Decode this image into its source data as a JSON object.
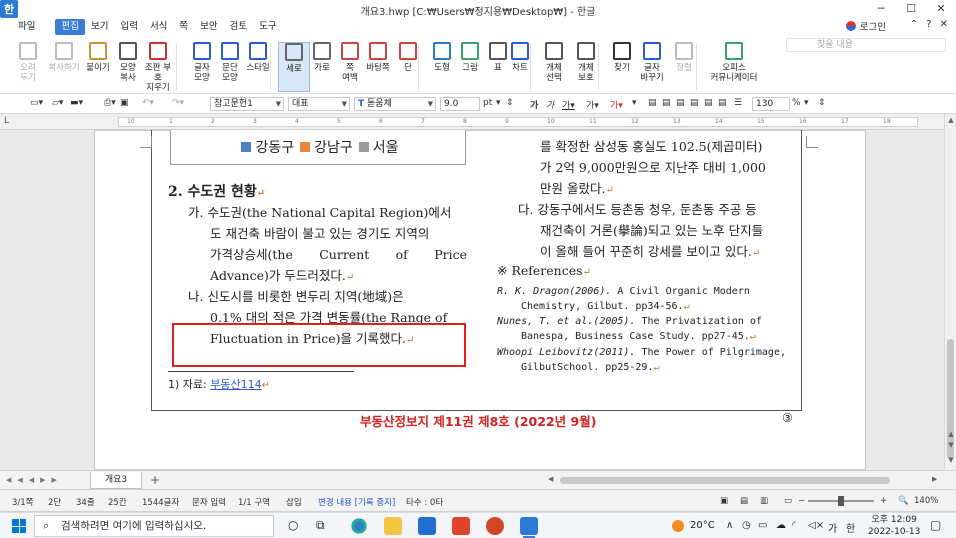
{
  "window": {
    "title": "개요3.hwp [C:₩Users₩정지용₩Desktop₩] - 한글",
    "app_logo": "한",
    "controls": [
      "─",
      "☐",
      "✕"
    ]
  },
  "menubar": {
    "items": [
      "파일",
      "편집",
      "보기",
      "입력",
      "서식",
      "쪽",
      "보안",
      "검토",
      "도구"
    ],
    "active": "편집",
    "login": "로그인",
    "right": [
      "⌃",
      "?",
      "✕"
    ]
  },
  "ribbon": {
    "search_placeholder": "찾을 내용",
    "buttons": [
      {
        "label1": "오려",
        "label2": "두기",
        "icon": "scissors-icon",
        "disabled": true
      },
      {
        "label1": "복사하기",
        "label2": "",
        "icon": "copy-icon",
        "disabled": true
      },
      {
        "label1": "붙이기",
        "label2": "",
        "icon": "paste-icon",
        "disabled": false
      },
      {
        "label1": "모양",
        "label2": "복사",
        "icon": "format-painter-icon",
        "disabled": false
      },
      {
        "label1": "조판 부호",
        "label2": "지우기",
        "icon": "clear-codes-icon",
        "disabled": false
      },
      {
        "label1": "글자",
        "label2": "모양",
        "icon": "char-shape-icon",
        "disabled": false
      },
      {
        "label1": "문단",
        "label2": "모양",
        "icon": "para-shape-icon",
        "disabled": false
      },
      {
        "label1": "스타일",
        "label2": "",
        "icon": "style-icon",
        "disabled": false
      },
      {
        "label1": "세로",
        "label2": "",
        "icon": "portrait-icon",
        "disabled": false,
        "selected": true
      },
      {
        "label1": "가로",
        "label2": "",
        "icon": "landscape-icon",
        "disabled": false
      },
      {
        "label1": "쪽",
        "label2": "여백",
        "icon": "margin-icon",
        "disabled": false
      },
      {
        "label1": "바탕쪽",
        "label2": "",
        "icon": "master-page-icon",
        "disabled": false
      },
      {
        "label1": "단",
        "label2": "",
        "icon": "columns-icon",
        "disabled": false
      },
      {
        "label1": "도형",
        "label2": "",
        "icon": "shapes-icon",
        "disabled": false
      },
      {
        "label1": "그림",
        "label2": "",
        "icon": "picture-icon",
        "disabled": false
      },
      {
        "label1": "표",
        "label2": "",
        "icon": "table-icon",
        "disabled": false
      },
      {
        "label1": "차트",
        "label2": "",
        "icon": "chart-icon",
        "disabled": false
      },
      {
        "label1": "개체",
        "label2": "선택",
        "icon": "object-select-icon",
        "disabled": false
      },
      {
        "label1": "개체",
        "label2": "보호",
        "icon": "object-protect-icon",
        "disabled": false
      },
      {
        "label1": "찾기",
        "label2": "",
        "icon": "find-icon",
        "disabled": false
      },
      {
        "label1": "글자",
        "label2": "바꾸기",
        "icon": "replace-icon",
        "disabled": false
      },
      {
        "label1": "정렬",
        "label2": "",
        "icon": "sort-icon",
        "disabled": true
      },
      {
        "label1": "오피스",
        "label2": "커뮤니케이터",
        "icon": "communicator-icon",
        "disabled": false
      }
    ]
  },
  "format": {
    "style": "참고문헌1",
    "lang": "대표",
    "font": "돋움체",
    "size": "9.0",
    "unit": "pt",
    "zoom": "130",
    "zoom_unit": "%",
    "font_icon": "T"
  },
  "ruler": {
    "ticks": [
      "10",
      "1",
      "2",
      "3",
      "4",
      "5",
      "6",
      "7",
      "8",
      "9",
      "10",
      "11",
      "12",
      "13",
      "14",
      "15",
      "16",
      "17",
      "18"
    ]
  },
  "document": {
    "legend": [
      {
        "label": "강동구",
        "color": "#4f7ec9"
      },
      {
        "label": "강남구",
        "color": "#e8883a"
      },
      {
        "label": "서울",
        "color": "#9a9a9a"
      }
    ],
    "section_title": "2. 수도권 현황",
    "left_col": [
      [
        "가. 수도권(the National Capital Region)에서"
      ],
      [
        "도 재건축 바람이 불고 있는 경기도 지역의"
      ],
      [
        "가격상승세(the",
        "Current",
        "of",
        "Price"
      ],
      [
        "Advance)가 두드러졌다."
      ],
      [
        "나. 신도시를 비롯한 변두리 지역(地域)은"
      ],
      [
        "0.1% 대의 적은 가격 변동률(the Range of"
      ],
      [
        "Fluctuation in Price)을 기록했다."
      ]
    ],
    "right_top": [
      [
        "를 확정한 삼성동 홍실도 102.5(제곱미터)"
      ],
      [
        "가 2억 9,000만원으로 지난주 대비 1,000"
      ],
      [
        "만원 올랐다."
      ]
    ],
    "right_da": [
      [
        "다. 강동구에서도 등촌동 청우, 둔촌동 주공 등"
      ],
      [
        "재건축이 거론(擧論)되고 있는 노후 단지들"
      ],
      [
        "이 올해 들어 꾸준히 강세를 보이고 있다."
      ]
    ],
    "references_title": "※ References",
    "references": [
      {
        "author": "R. K. Dragon(2006).",
        "rest": " A Civil Organic Modern",
        "cont": "Chemistry, Gilbut. pp34-56."
      },
      {
        "author": "Nunes, T. et al.(2005).",
        "rest": " The Privatization of",
        "cont": "Banespa, Business Case Study. pp27-45."
      },
      {
        "author": "Whoopi Leibovitz(2011).",
        "rest": " The Power of Pilgrimage,",
        "cont": "GilbutSchool. pp25-29."
      }
    ],
    "footnote_prefix": "1) 자료: ",
    "footnote_link": "부동산114",
    "footer": "부동산정보지 제11권 제8호 (2022년 9월)",
    "page_number": "③"
  },
  "tabbar": {
    "doc_tab": "개요3",
    "add": "+"
  },
  "status": {
    "page": "3/1쪽",
    "column": "2단",
    "line": "34줄",
    "col": "25칸",
    "chars": "1544글자",
    "mode": "문자 입력",
    "section": "1/1 구역",
    "insert": "삽입",
    "track": "변경 내용 [기록 중지]",
    "typo": "타수 : 0타",
    "zoom": "140%"
  },
  "taskbar": {
    "search_placeholder": "검색하려면 여기에 입력하십시오.",
    "weather": "20°C",
    "time": "오후 12:09",
    "date": "2022-10-13",
    "ime": "한",
    "lang": "가"
  }
}
